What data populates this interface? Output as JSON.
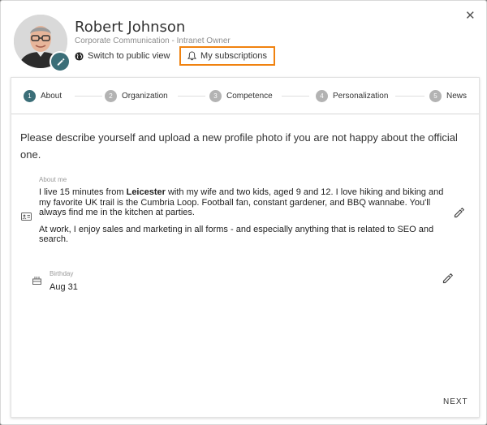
{
  "profile": {
    "name": "Robert Johnson",
    "role": "Corporate Communication - Intranet Owner",
    "switch_label": "Switch to public view",
    "subscriptions_label": "My subscriptions",
    "close_icon": "close-icon"
  },
  "steps": [
    {
      "num": "1",
      "label": "About",
      "active": true
    },
    {
      "num": "2",
      "label": "Organization",
      "active": false
    },
    {
      "num": "3",
      "label": "Competence",
      "active": false
    },
    {
      "num": "4",
      "label": "Personalization",
      "active": false
    },
    {
      "num": "5",
      "label": "News",
      "active": false
    }
  ],
  "content": {
    "intro": "Please describe yourself and upload a new profile photo if you are not happy about the official one.",
    "about": {
      "label": "About me",
      "p1_before": "I live 15 minutes from ",
      "p1_bold": "Leicester",
      "p1_after": " with my wife and two kids, aged 9 and 12. I love hiking and biking and my favorite UK trail is the Cumbria Loop. Football fan, constant gardener, and BBQ wannabe. You'll always find me in the kitchen at parties.",
      "p2": "At work, I enjoy sales and marketing in all forms - and especially anything that is related to SEO and search."
    },
    "birthday": {
      "label": "Birthday",
      "value": "Aug 31"
    }
  },
  "footer": {
    "next_label": "NEXT"
  },
  "colors": {
    "accent": "#3b6e78",
    "highlight": "#f0820f",
    "step_inactive": "#b3b3b3"
  }
}
